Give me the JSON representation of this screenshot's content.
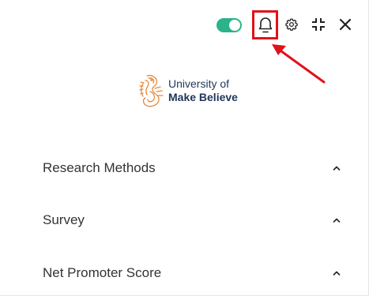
{
  "toolbar": {
    "toggle_state": "on",
    "toggle_color": "#2bb38a",
    "icons": [
      "bell-icon",
      "gear-icon",
      "collapse-icon",
      "close-icon"
    ],
    "highlight_color": "#e0121b"
  },
  "logo": {
    "line1": "University of",
    "line2": "Make Believe",
    "mark_color": "#e58a3c"
  },
  "sections": [
    {
      "label": "Research Methods",
      "expanded": true
    },
    {
      "label": "Survey",
      "expanded": true
    },
    {
      "label": "Net Promoter Score",
      "expanded": true
    }
  ]
}
